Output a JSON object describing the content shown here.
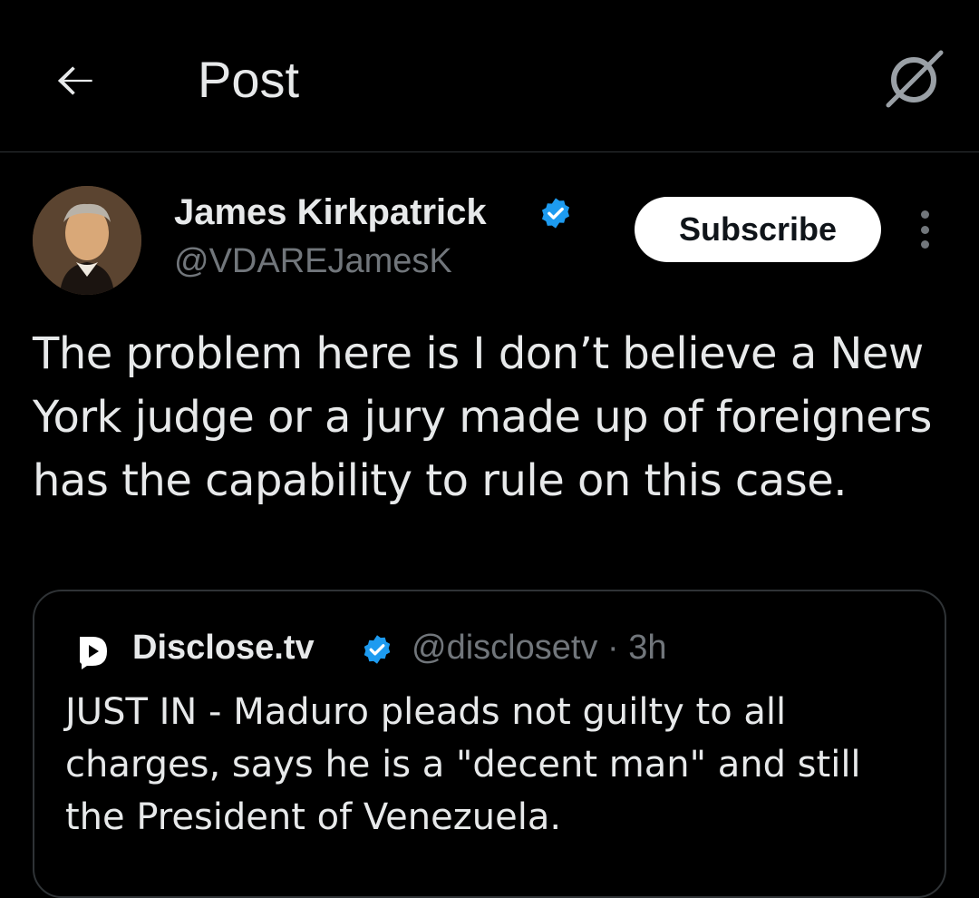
{
  "header": {
    "title": "Post",
    "back_icon": "arrow-left-icon",
    "grok_icon": "grok-slash-icon"
  },
  "post": {
    "author": {
      "name": "James Kirkpatrick",
      "handle": "@VDAREJamesK",
      "verified": true,
      "verified_color": "#1d9bf0"
    },
    "subscribe_label": "Subscribe",
    "more_icon": "more-vertical-icon",
    "text": "The problem here is I don’t believe a New York judge or a jury made up of foreigners has the capability to rule on this case."
  },
  "quote": {
    "name": "Disclose.tv",
    "verified": true,
    "handle": "@disclosetv",
    "separator": "·",
    "time": "3h",
    "text": "JUST IN - Maduro pleads not guilty to all charges, says he is a \"decent man\" and still the President of Venezuela."
  },
  "colors": {
    "background": "#000000",
    "text_primary": "#e7e9ea",
    "text_secondary": "#71767b",
    "border": "#2f3336",
    "accent": "#1d9bf0"
  }
}
